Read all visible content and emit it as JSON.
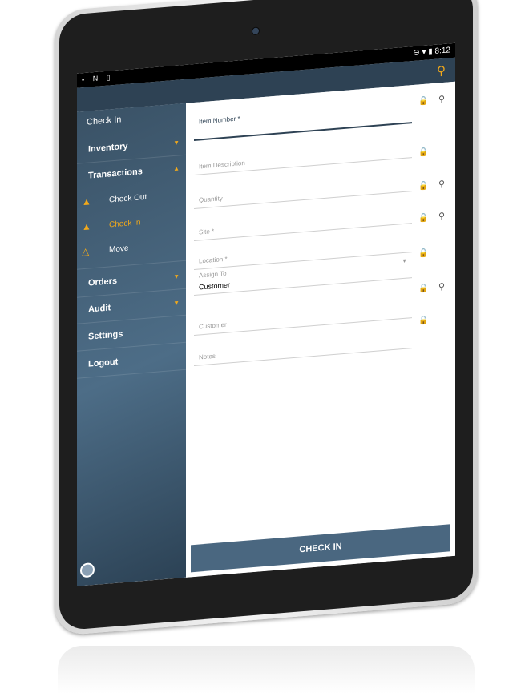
{
  "status_bar": {
    "left_icons": "▪ N ▯",
    "right_icons": "⊖ ▾ ▮",
    "time": "8:12"
  },
  "app_bar": {
    "search_icon": "search-icon"
  },
  "drawer": {
    "title": "Check In",
    "items": [
      {
        "label": "Inventory"
      },
      {
        "label": "Transactions"
      },
      {
        "label": "Orders"
      },
      {
        "label": "Audit"
      },
      {
        "label": "Settings"
      },
      {
        "label": "Logout"
      }
    ],
    "sub_items": [
      {
        "label": "Check Out",
        "icon": "basket-icon"
      },
      {
        "label": "Check In",
        "icon": "basket-icon"
      },
      {
        "label": "Move",
        "icon": "dolly-icon"
      }
    ],
    "accent": "#f2a91a"
  },
  "form": {
    "item_number": {
      "label": "Item Number *",
      "value": ""
    },
    "item_description": {
      "label": "Item Description"
    },
    "quantity": {
      "label": "Quantity"
    },
    "site": {
      "label": "Site *"
    },
    "location": {
      "label": "Location *"
    },
    "assign_to": {
      "label": "Assign To",
      "value": "Customer"
    },
    "customer": {
      "label": "Customer"
    },
    "notes": {
      "label": "Notes"
    }
  },
  "check_in_button": {
    "label": "CHECK IN"
  }
}
